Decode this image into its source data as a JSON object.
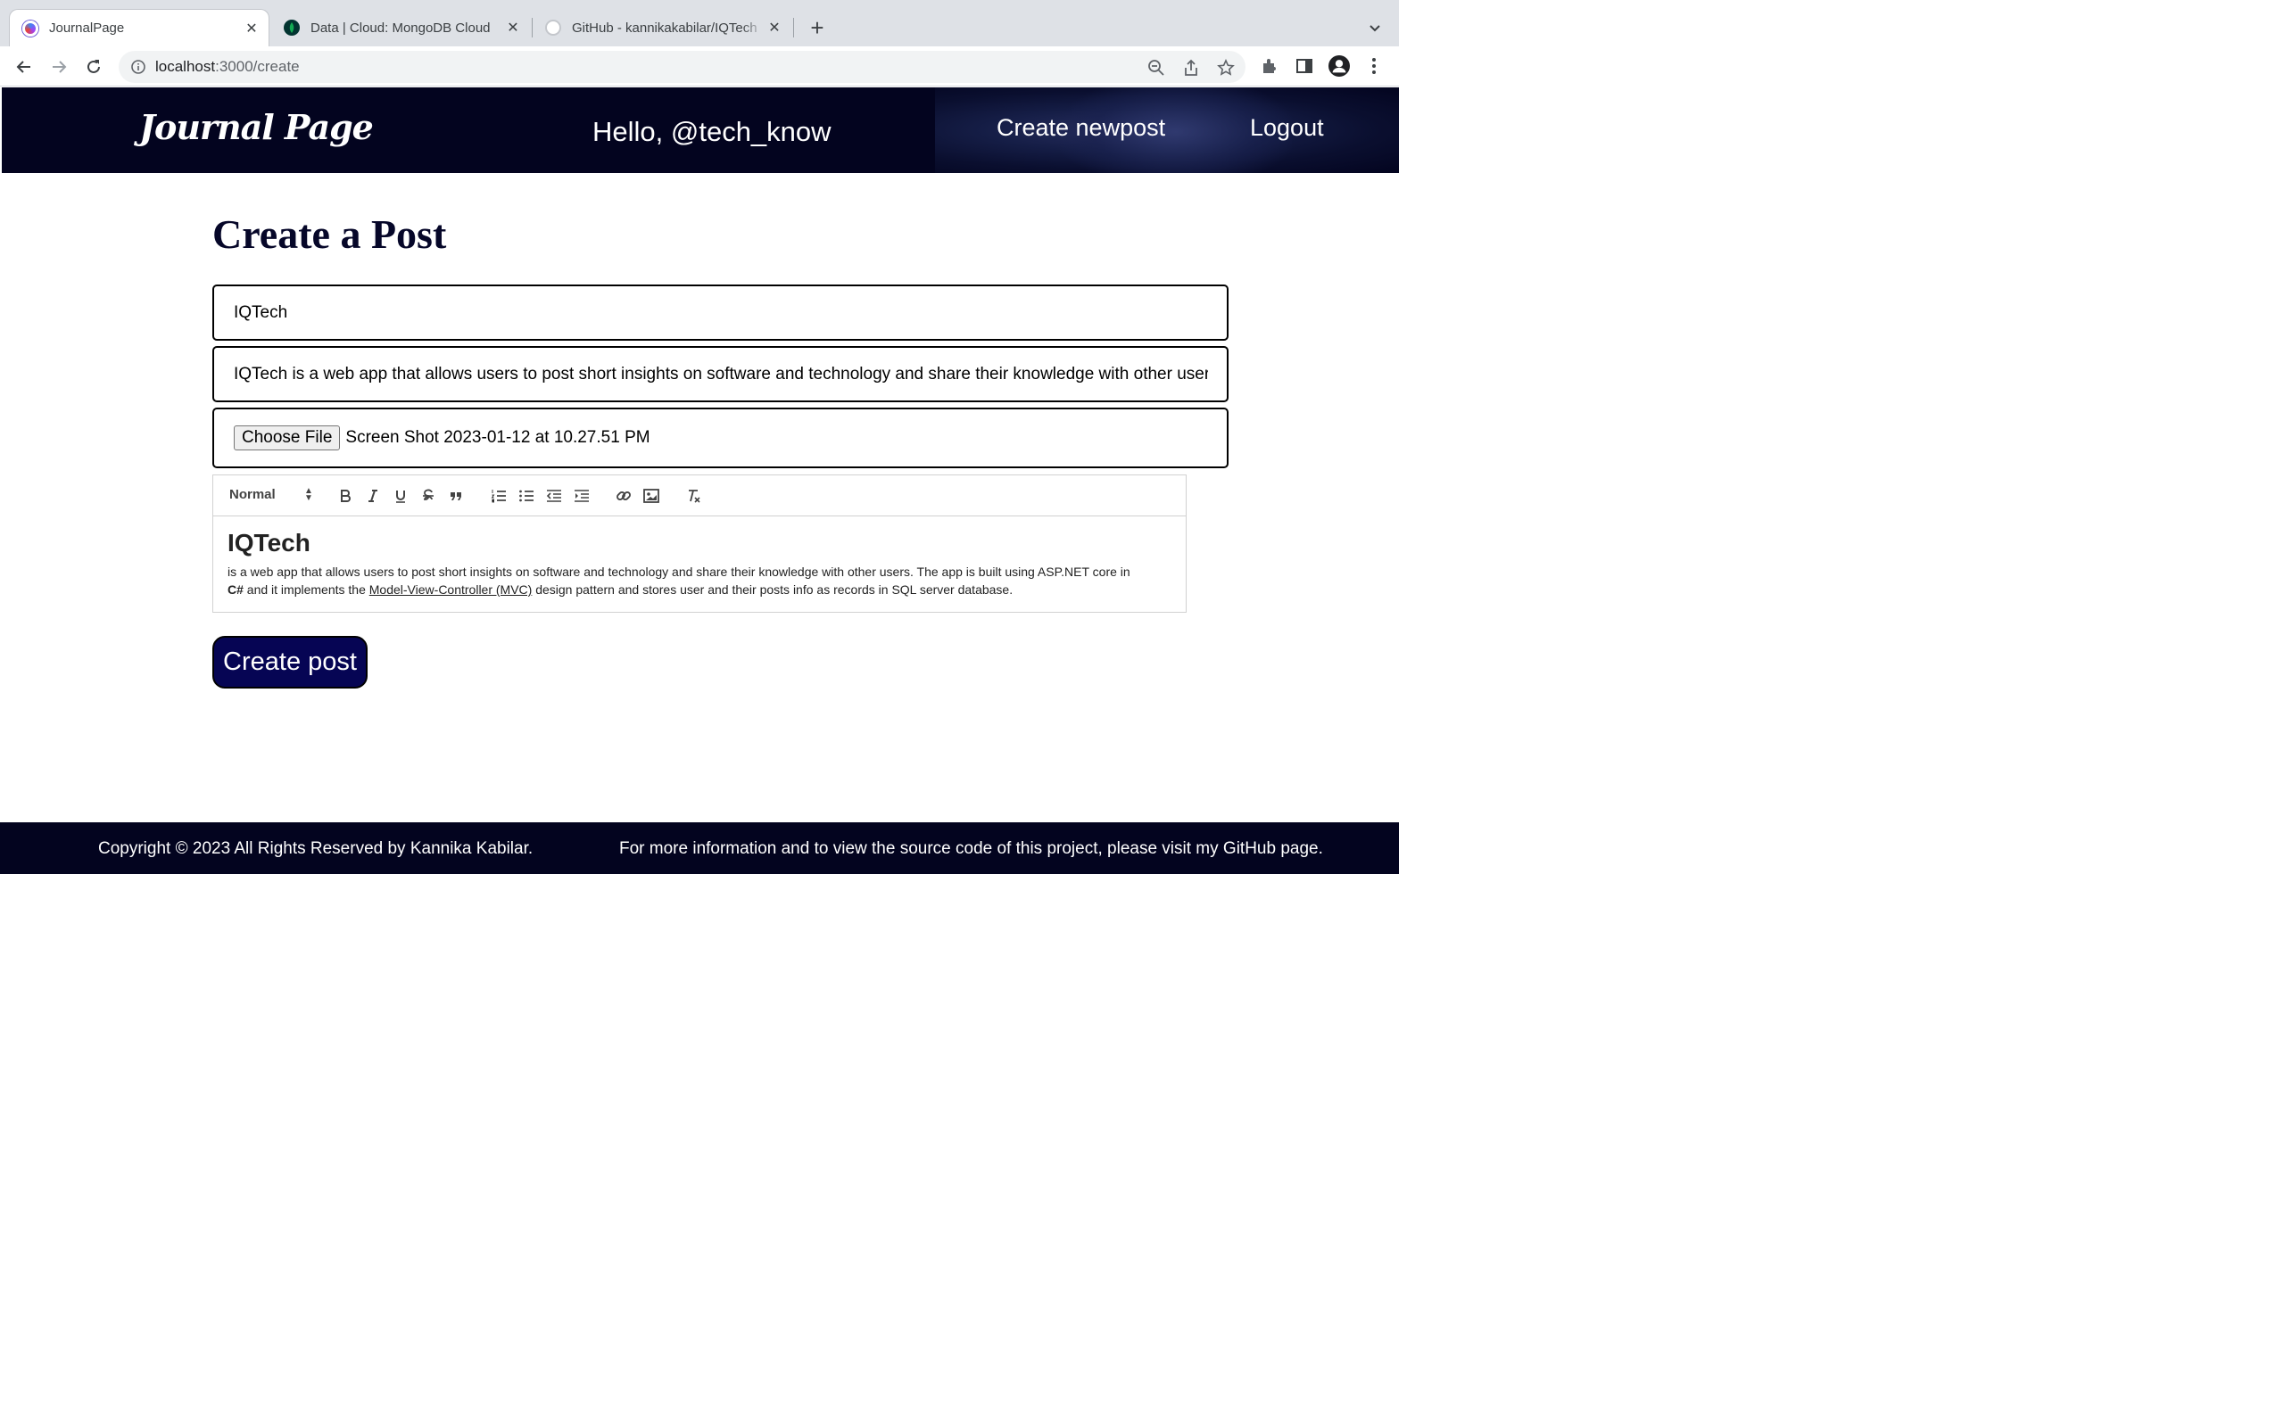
{
  "browser": {
    "tabs": [
      {
        "title": "JournalPage",
        "active": true
      },
      {
        "title": "Data | Cloud: MongoDB Cloud",
        "active": false
      },
      {
        "title": "GitHub - kannikakabilar/IQTech",
        "active": false
      }
    ],
    "url_host": "localhost",
    "url_path": ":3000/create"
  },
  "site": {
    "logo": "Journal Page",
    "greeting": "Hello, @tech_know",
    "nav": {
      "create": "Create newpost",
      "logout": "Logout"
    }
  },
  "form": {
    "heading": "Create a Post",
    "title_value": "IQTech",
    "summary_value": "IQTech is a web app that allows users to post short insights on software and technology and share their knowledge with other users.",
    "file_button": "Choose File",
    "file_name": "Screen Shot 2023-01-12 at 10.27.51 PM",
    "editor": {
      "format_picker": "Normal",
      "heading": "IQTech",
      "para_part1": "is a web app that allows users to post short insights on software and technology and share their knowledge with other users. The app is built using ASP.NET core in",
      "bold_text": "C#",
      "para_part2": " and it implements the ",
      "link_text": "Model-View-Controller (MVC)",
      "para_part3": " design pattern and stores user and their posts info as records in SQL server database."
    },
    "submit": "Create post"
  },
  "footer": {
    "copyright": "Copyright © 2023 All Rights Reserved by Kannika Kabilar.",
    "info": "For more information and to view the source code of this project, please visit my GitHub page."
  },
  "colors": {
    "header_bg": "#03041f",
    "button_bg": "#060554",
    "heading": "#060729"
  }
}
